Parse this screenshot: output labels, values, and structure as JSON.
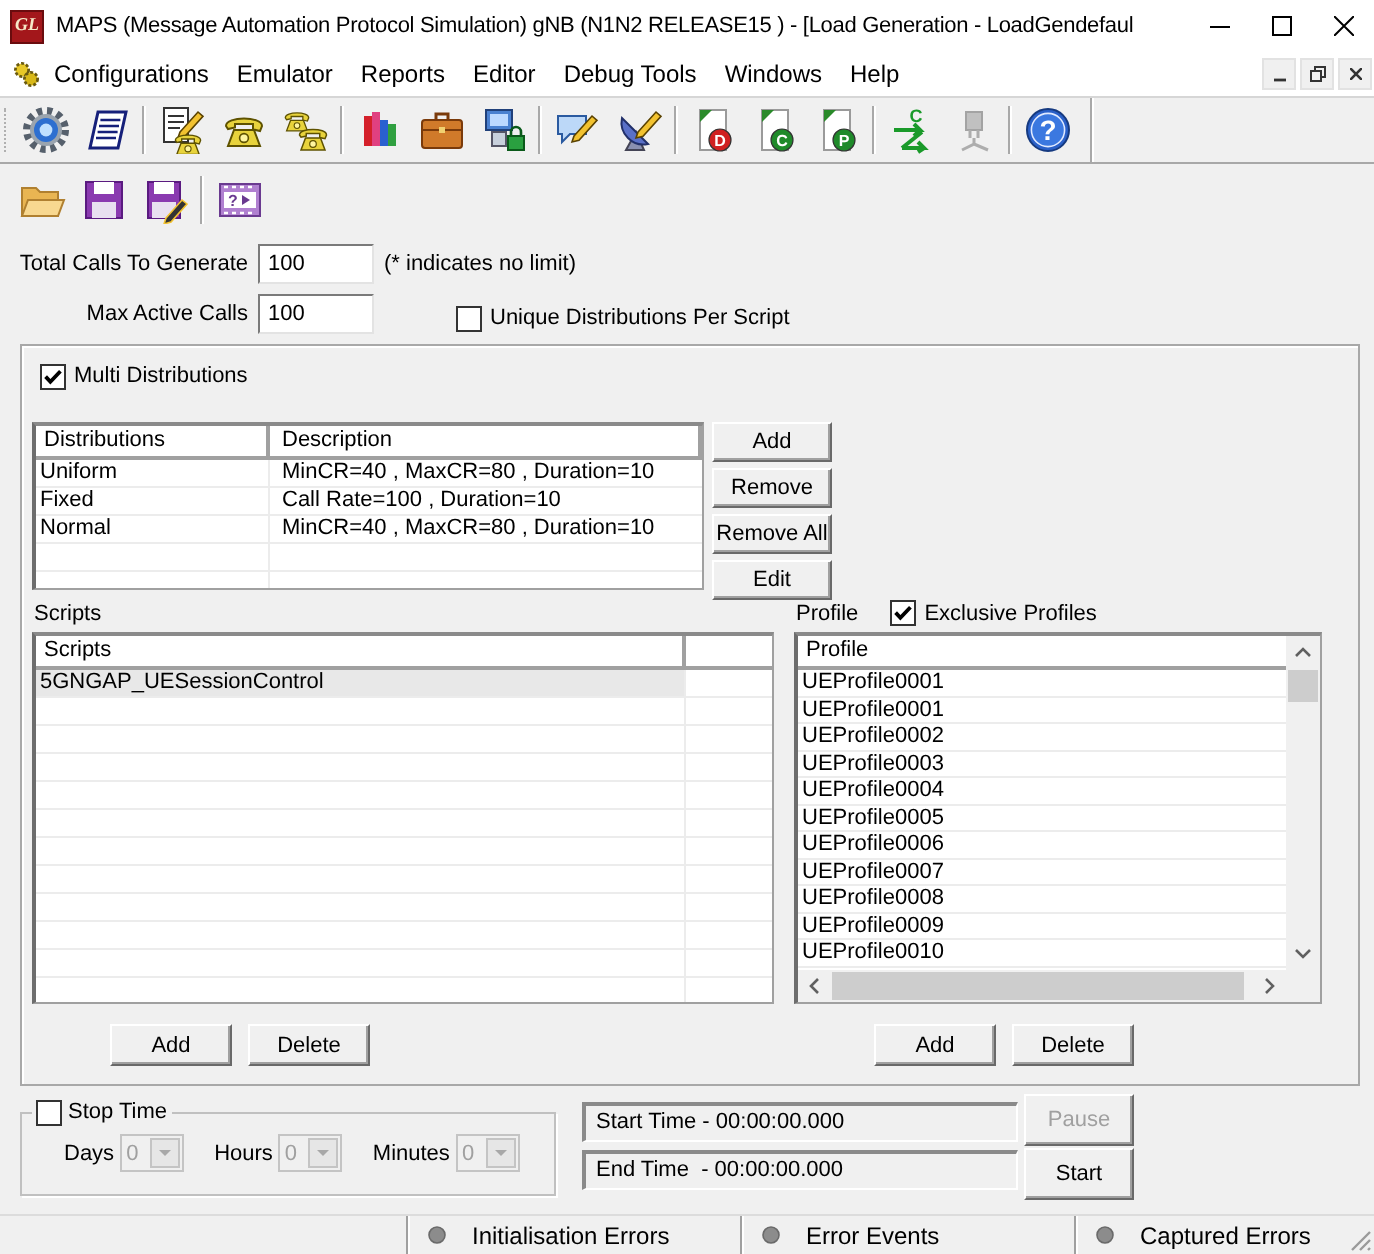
{
  "window": {
    "logo": "GL",
    "title": "MAPS (Message Automation Protocol Simulation) gNB (N1N2 RELEASE15 ) - [Load Generation - LoadGendefaul"
  },
  "menu": [
    "Configurations",
    "Emulator",
    "Reports",
    "Editor",
    "Debug Tools",
    "Windows",
    "Help"
  ],
  "toolbar": [
    {
      "items": [
        {
          "disabled": false
        },
        {
          "disabled": false
        }
      ]
    },
    {
      "items": [
        {
          "disabled": false
        },
        {
          "disabled": false
        },
        {
          "disabled": false
        }
      ]
    },
    {
      "items": [
        {
          "disabled": false
        },
        {
          "disabled": false
        },
        {
          "disabled": false
        }
      ]
    },
    {
      "items": [
        {
          "disabled": false
        },
        {
          "disabled": false
        }
      ]
    },
    {
      "items": [
        {
          "disabled": false,
          "glyph": "D"
        },
        {
          "disabled": false,
          "glyph": "C"
        },
        {
          "disabled": false,
          "glyph": "P"
        }
      ]
    },
    {
      "items": [
        {
          "disabled": false,
          "glyph": "C"
        },
        {
          "disabled": true
        }
      ]
    },
    {
      "items": [
        {
          "disabled": false,
          "glyph": "?"
        }
      ]
    }
  ],
  "file_toolbar": [
    {
      "items": [
        {
          "disabled": false
        },
        {
          "disabled": false
        },
        {
          "disabled": false
        }
      ]
    },
    {
      "items": [
        {
          "disabled": false,
          "glyph": "?"
        }
      ]
    }
  ],
  "calls": {
    "total": {
      "label": "Total Calls To Generate",
      "value": "100"
    },
    "hint": "(* indicates no limit)",
    "max_active": {
      "label": "Max Active Calls",
      "value": "100"
    }
  },
  "unique_distributions": {
    "label": "Unique Distributions Per Script",
    "checked": false
  },
  "multi_distributions": {
    "label": "Multi Distributions",
    "checked": true
  },
  "distributions": {
    "columns": [
      "Distributions",
      "Description"
    ],
    "rows": [
      {
        "name": "Uniform",
        "description": "MinCR=40 , MaxCR=80 , Duration=10",
        "selected": false
      },
      {
        "name": "Fixed",
        "description": "Call Rate=100 , Duration=10",
        "selected": false
      },
      {
        "name": "Normal",
        "description": "MinCR=40 , MaxCR=80 , Duration=10",
        "selected": false
      }
    ],
    "buttons": [
      "Add",
      "Remove",
      "Remove All",
      "Edit"
    ]
  },
  "scripts": {
    "title": "Scripts",
    "column": "Scripts",
    "rows": [
      {
        "name": "5GNGAP_UESessionControl",
        "selected": true
      }
    ],
    "buttons": [
      "Add",
      "Delete"
    ]
  },
  "profiles": {
    "title": "Profile",
    "exclusive": {
      "label": "Exclusive Profiles",
      "checked": true
    },
    "column": "Profile",
    "rows": [
      {
        "name": "UEProfile0001",
        "selected": false
      },
      {
        "name": "UEProfile0001",
        "selected": false
      },
      {
        "name": "UEProfile0002",
        "selected": false
      },
      {
        "name": "UEProfile0003",
        "selected": false
      },
      {
        "name": "UEProfile0004",
        "selected": false
      },
      {
        "name": "UEProfile0005",
        "selected": false
      },
      {
        "name": "UEProfile0006",
        "selected": false
      },
      {
        "name": "UEProfile0007",
        "selected": false
      },
      {
        "name": "UEProfile0008",
        "selected": false
      },
      {
        "name": "UEProfile0009",
        "selected": false
      },
      {
        "name": "UEProfile0010",
        "selected": false
      }
    ],
    "buttons": [
      "Add",
      "Delete"
    ]
  },
  "stop_time": {
    "label": "Stop Time",
    "checked": false,
    "fields": [
      {
        "label": "Days",
        "value": "0",
        "disabled": true
      },
      {
        "label": "Hours",
        "value": "0",
        "disabled": true
      },
      {
        "label": "Minutes",
        "value": "0",
        "disabled": true
      }
    ]
  },
  "times": [
    "Start Time - 00:00:00.000",
    "End Time  - 00:00:00.000"
  ],
  "run_buttons": [
    {
      "label": "Pause",
      "disabled": true
    },
    {
      "label": "Start",
      "disabled": false
    }
  ],
  "status_bar": [
    "Initialisation Errors",
    "Error Events",
    "Captured Errors"
  ]
}
